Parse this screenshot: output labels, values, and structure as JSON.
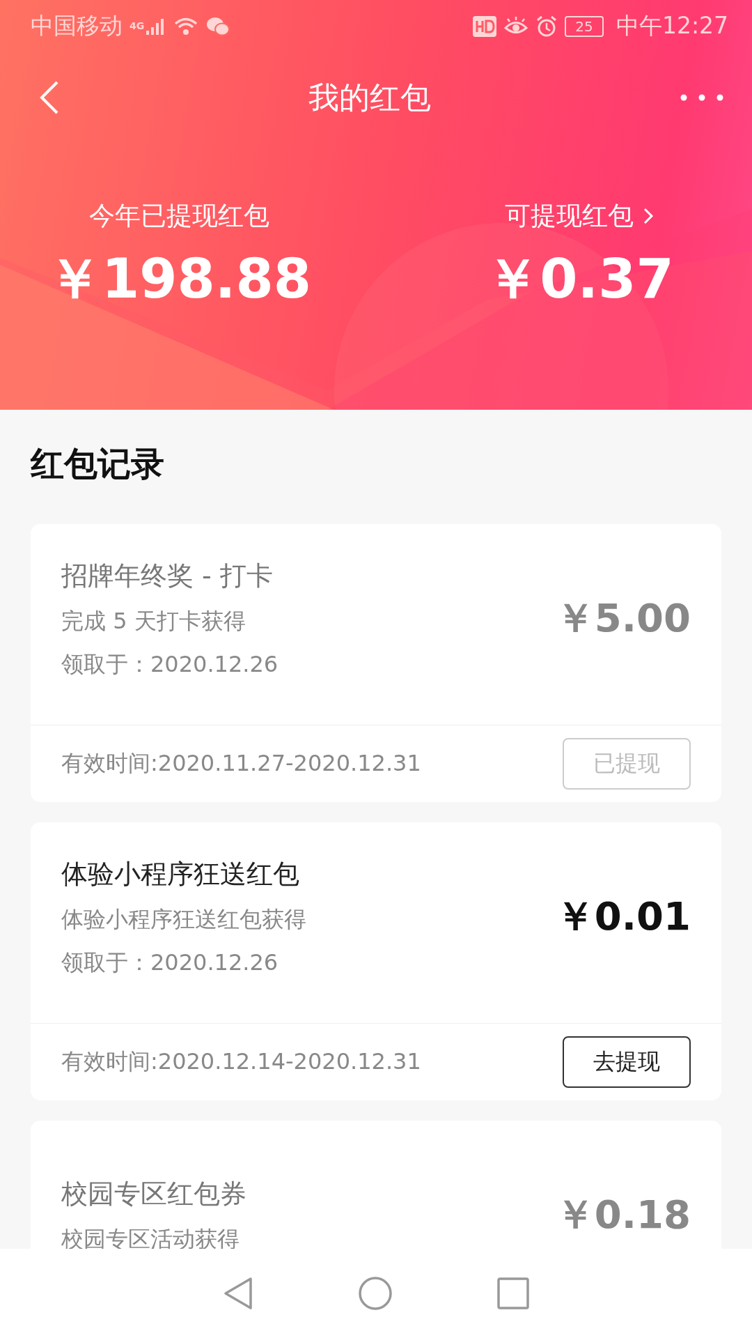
{
  "status_bar": {
    "carrier": "中国移动",
    "network": "4G",
    "battery": "25",
    "time": "中午12:27"
  },
  "nav": {
    "title": "我的红包"
  },
  "summary": [
    {
      "label": "今年已提现红包",
      "amount": "￥198.88",
      "link": false
    },
    {
      "label": "可提现红包",
      "amount": "￥0.37",
      "link": true
    }
  ],
  "section_title": "红包记录",
  "records": [
    {
      "title": "招牌年终奖 - 打卡",
      "source": "完成 5 天打卡获得",
      "received": "领取于：2020.12.26",
      "amount": "￥5.00",
      "withdrawn": true,
      "validity": "有效时间:2020.11.27-2020.12.31",
      "button": "已提现"
    },
    {
      "title": "体验小程序狂送红包",
      "source": "体验小程序狂送红包获得",
      "received": "领取于：2020.12.26",
      "amount": "￥0.01",
      "withdrawn": false,
      "validity": "有效时间:2020.12.14-2020.12.31",
      "button": "去提现"
    },
    {
      "title": "校园专区红包券",
      "source": "校园专区活动获得",
      "amount": "￥0.18",
      "withdrawn": true
    }
  ]
}
